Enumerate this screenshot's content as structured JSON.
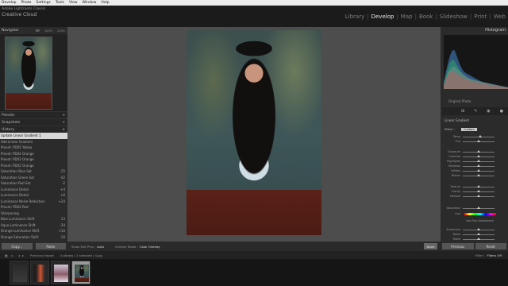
{
  "menubar": [
    "Develop",
    "Photo",
    "Settings",
    "Tools",
    "View",
    "Window",
    "Help"
  ],
  "identity": {
    "line1": "Adobe Lightroom Classic",
    "line2": "Creative Cloud"
  },
  "modules": [
    "Library",
    "Develop",
    "Map",
    "Book",
    "Slideshow",
    "Print",
    "Web"
  ],
  "active_module": "Develop",
  "left_panel": {
    "navigator": {
      "label": "Navigator",
      "zoom": [
        "FIT",
        "100%",
        "200%"
      ]
    },
    "presets": {
      "label": "Presets"
    },
    "snapshots": {
      "label": "Snapshots"
    },
    "history": {
      "label": "History",
      "items": [
        {
          "name": "Update Linear Gradient 1",
          "value": ""
        },
        {
          "name": "Add Linear Gradient",
          "value": ""
        },
        {
          "name": "Preset: PD05 Yellow",
          "value": ""
        },
        {
          "name": "Preset: PD04 Orange",
          "value": ""
        },
        {
          "name": "Preset: PD03 Orange",
          "value": ""
        },
        {
          "name": "Preset: PD02 Orange",
          "value": ""
        },
        {
          "name": "Saturation Blue Sat",
          "value": "-25"
        },
        {
          "name": "Saturation Green Sat",
          "value": "-42"
        },
        {
          "name": "Saturation Red Sat",
          "value": "-2"
        },
        {
          "name": "Luminance Detail",
          "value": "+4"
        },
        {
          "name": "Luminance Detail",
          "value": "+6"
        },
        {
          "name": "Luminance Noise Reduction",
          "value": "+24"
        },
        {
          "name": "Preset: PD02 Red",
          "value": ""
        },
        {
          "name": "Sharpening",
          "value": ""
        },
        {
          "name": "Blue Luminance Shift",
          "value": "-13"
        },
        {
          "name": "Aqua Luminance Shift",
          "value": "-24"
        },
        {
          "name": "Orange Luminance Shift",
          "value": "+10"
        },
        {
          "name": "Orange Saturation Shift",
          "value": "-10"
        }
      ]
    },
    "copy_label": "Copy...",
    "paste_label": "Paste"
  },
  "toolbar": {
    "show_edit_pins_label": "Show Edit Pins :",
    "show_edit_pins_value": "Auto",
    "overlay_mode_label": "Overlay Mode :",
    "overlay_mode_value": "Color Overlay",
    "done_label": "Done"
  },
  "right_panel": {
    "histogram_label": "Histogram",
    "original_photo_label": "Original Photo",
    "mask_label": "Linear Gradient",
    "effect_label": "Effect :",
    "effect_value": "Custom",
    "sliders": [
      {
        "name": "Temp",
        "value": 0.55
      },
      {
        "name": "Tint",
        "value": 0.5
      },
      {
        "name": "Exposure",
        "value": 0.5
      },
      {
        "name": "Contrast",
        "value": 0.5
      },
      {
        "name": "Highlights",
        "value": 0.5
      },
      {
        "name": "Shadows",
        "value": 0.5
      },
      {
        "name": "Whites",
        "value": 0.5
      },
      {
        "name": "Blacks",
        "value": 0.5
      },
      {
        "name": "Texture",
        "value": 0.5
      },
      {
        "name": "Clarity",
        "value": 0.5
      },
      {
        "name": "Dehaze",
        "value": 0.5
      },
      {
        "name": "Saturation",
        "value": 0.5
      },
      {
        "name": "Sharpness",
        "value": 0.5
      },
      {
        "name": "Noise",
        "value": 0.5
      },
      {
        "name": "Moiré",
        "value": 0.5
      },
      {
        "name": "Defringe",
        "value": 0.5
      }
    ],
    "hue_label": "Hue",
    "fine_hue_label": "Use Fine Adjustment",
    "previous_label": "Previous",
    "reset_label": "Reset"
  },
  "filmstrip": {
    "source_label": "Previous Import",
    "count_label": "4 photos / 1 selected / 4.jpg",
    "filter_label": "Filter :",
    "filter_value": "Filters Off",
    "thumbs": [
      {
        "selected": false
      },
      {
        "selected": false
      },
      {
        "selected": false
      },
      {
        "selected": true
      }
    ]
  }
}
